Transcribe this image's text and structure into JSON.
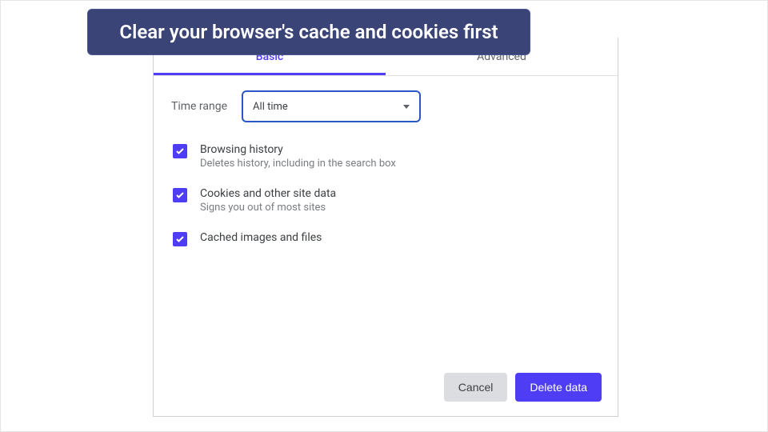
{
  "banner": {
    "text": "Clear your browser's cache and cookies first"
  },
  "tabs": {
    "basic": "Basic",
    "advanced": "Advanced"
  },
  "time_range": {
    "label": "Time range",
    "value": "All time"
  },
  "options": [
    {
      "title": "Browsing history",
      "sub": "Deletes history, including in the search box",
      "checked": true
    },
    {
      "title": "Cookies and other site data",
      "sub": "Signs you out of most sites",
      "checked": true
    },
    {
      "title": "Cached images and files",
      "sub": "",
      "checked": true
    }
  ],
  "buttons": {
    "cancel": "Cancel",
    "delete": "Delete data"
  },
  "colors": {
    "accent": "#4f3df5",
    "banner_bg": "#3a4476",
    "select_border": "#2a56c6"
  }
}
